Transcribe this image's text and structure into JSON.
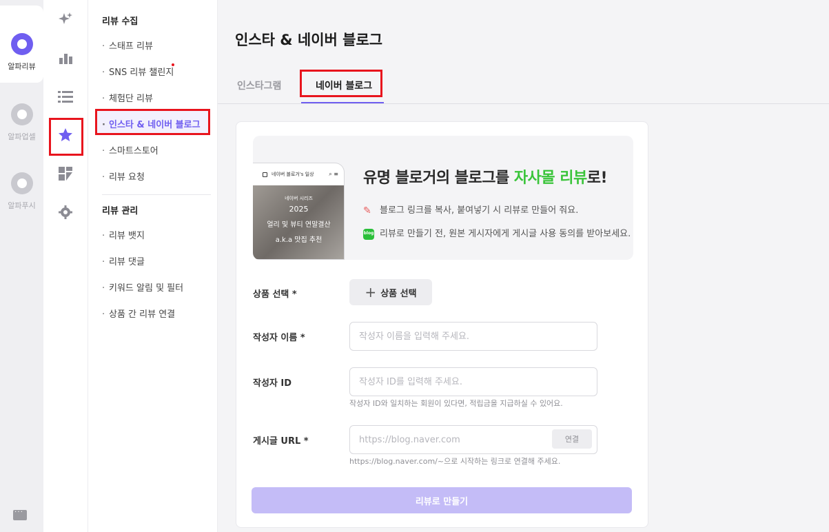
{
  "app_rail": {
    "apps": [
      {
        "label": "알파리뷰",
        "active": true
      },
      {
        "label": "알파업셀",
        "active": false
      },
      {
        "label": "알파푸시",
        "active": false
      }
    ]
  },
  "icon_rail": {
    "icons": [
      "sparkle-icon",
      "bar-chart-icon",
      "list-icon",
      "star-icon",
      "dashboard-icon",
      "gear-icon"
    ],
    "active": "star-icon"
  },
  "menu": {
    "section1": "리뷰 수집",
    "items1": [
      "스태프 리뷰",
      "SNS 리뷰 챌린지",
      "체험단 리뷰",
      "인스타 & 네이버 블로그",
      "스마트스토어",
      "리뷰 요청"
    ],
    "section2": "리뷰 관리",
    "items2": [
      "리뷰 뱃지",
      "리뷰 댓글",
      "키워드 알림 및 필터",
      "상품 간 리뷰 연결"
    ],
    "bullet": "·"
  },
  "main": {
    "title": "인스타 & 네이버 블로그",
    "tabs": [
      "인스타그램",
      "네이버 블로그"
    ],
    "active_tab": "네이버 블로그"
  },
  "banner": {
    "phone_header": "네이버 블로거's 일상",
    "phone_text": [
      "네이버 시리즈",
      "2025",
      "얼리 및 뷰티 연말결산",
      "a.k.a 맛집 추천"
    ],
    "title_prefix": "유명 블로거의 블로그를 ",
    "title_highlight": "자사몰 리뷰",
    "title_suffix": "로!",
    "line1": "블로그 링크를 복사, 붙여넣기 시 리뷰로 만들어 줘요.",
    "line2": "리뷰로 만들기 전, 원본 게시자에게 게시글 사용 동의를 받아보세요.",
    "blog_badge": "blog"
  },
  "form": {
    "product_label": "상품 선택 *",
    "product_button": "상품 선택",
    "product_plus": "+",
    "author_name_label": "작성자 이름 *",
    "author_name_placeholder": "작성자 이름을 입력해 주세요.",
    "author_id_label": "작성자 ID",
    "author_id_placeholder": "작성자 ID를 입력해 주세요.",
    "author_id_help": "작성자 ID와 일치하는 회원이 있다면, 적립금을 지급하실 수 있어요.",
    "url_label": "게시글 URL *",
    "url_placeholder": "https://blog.naver.com",
    "url_connect": "연결",
    "url_help": "https://blog.naver.com/~으로 시작하는 링크로 연결해 주세요.",
    "submit": "리뷰로 만들기"
  },
  "colors": {
    "accent": "#6f5ef0",
    "highlight_green": "#3ac43a",
    "annotation_red": "#e8141d",
    "submit_disabled": "#c4bcf7"
  }
}
